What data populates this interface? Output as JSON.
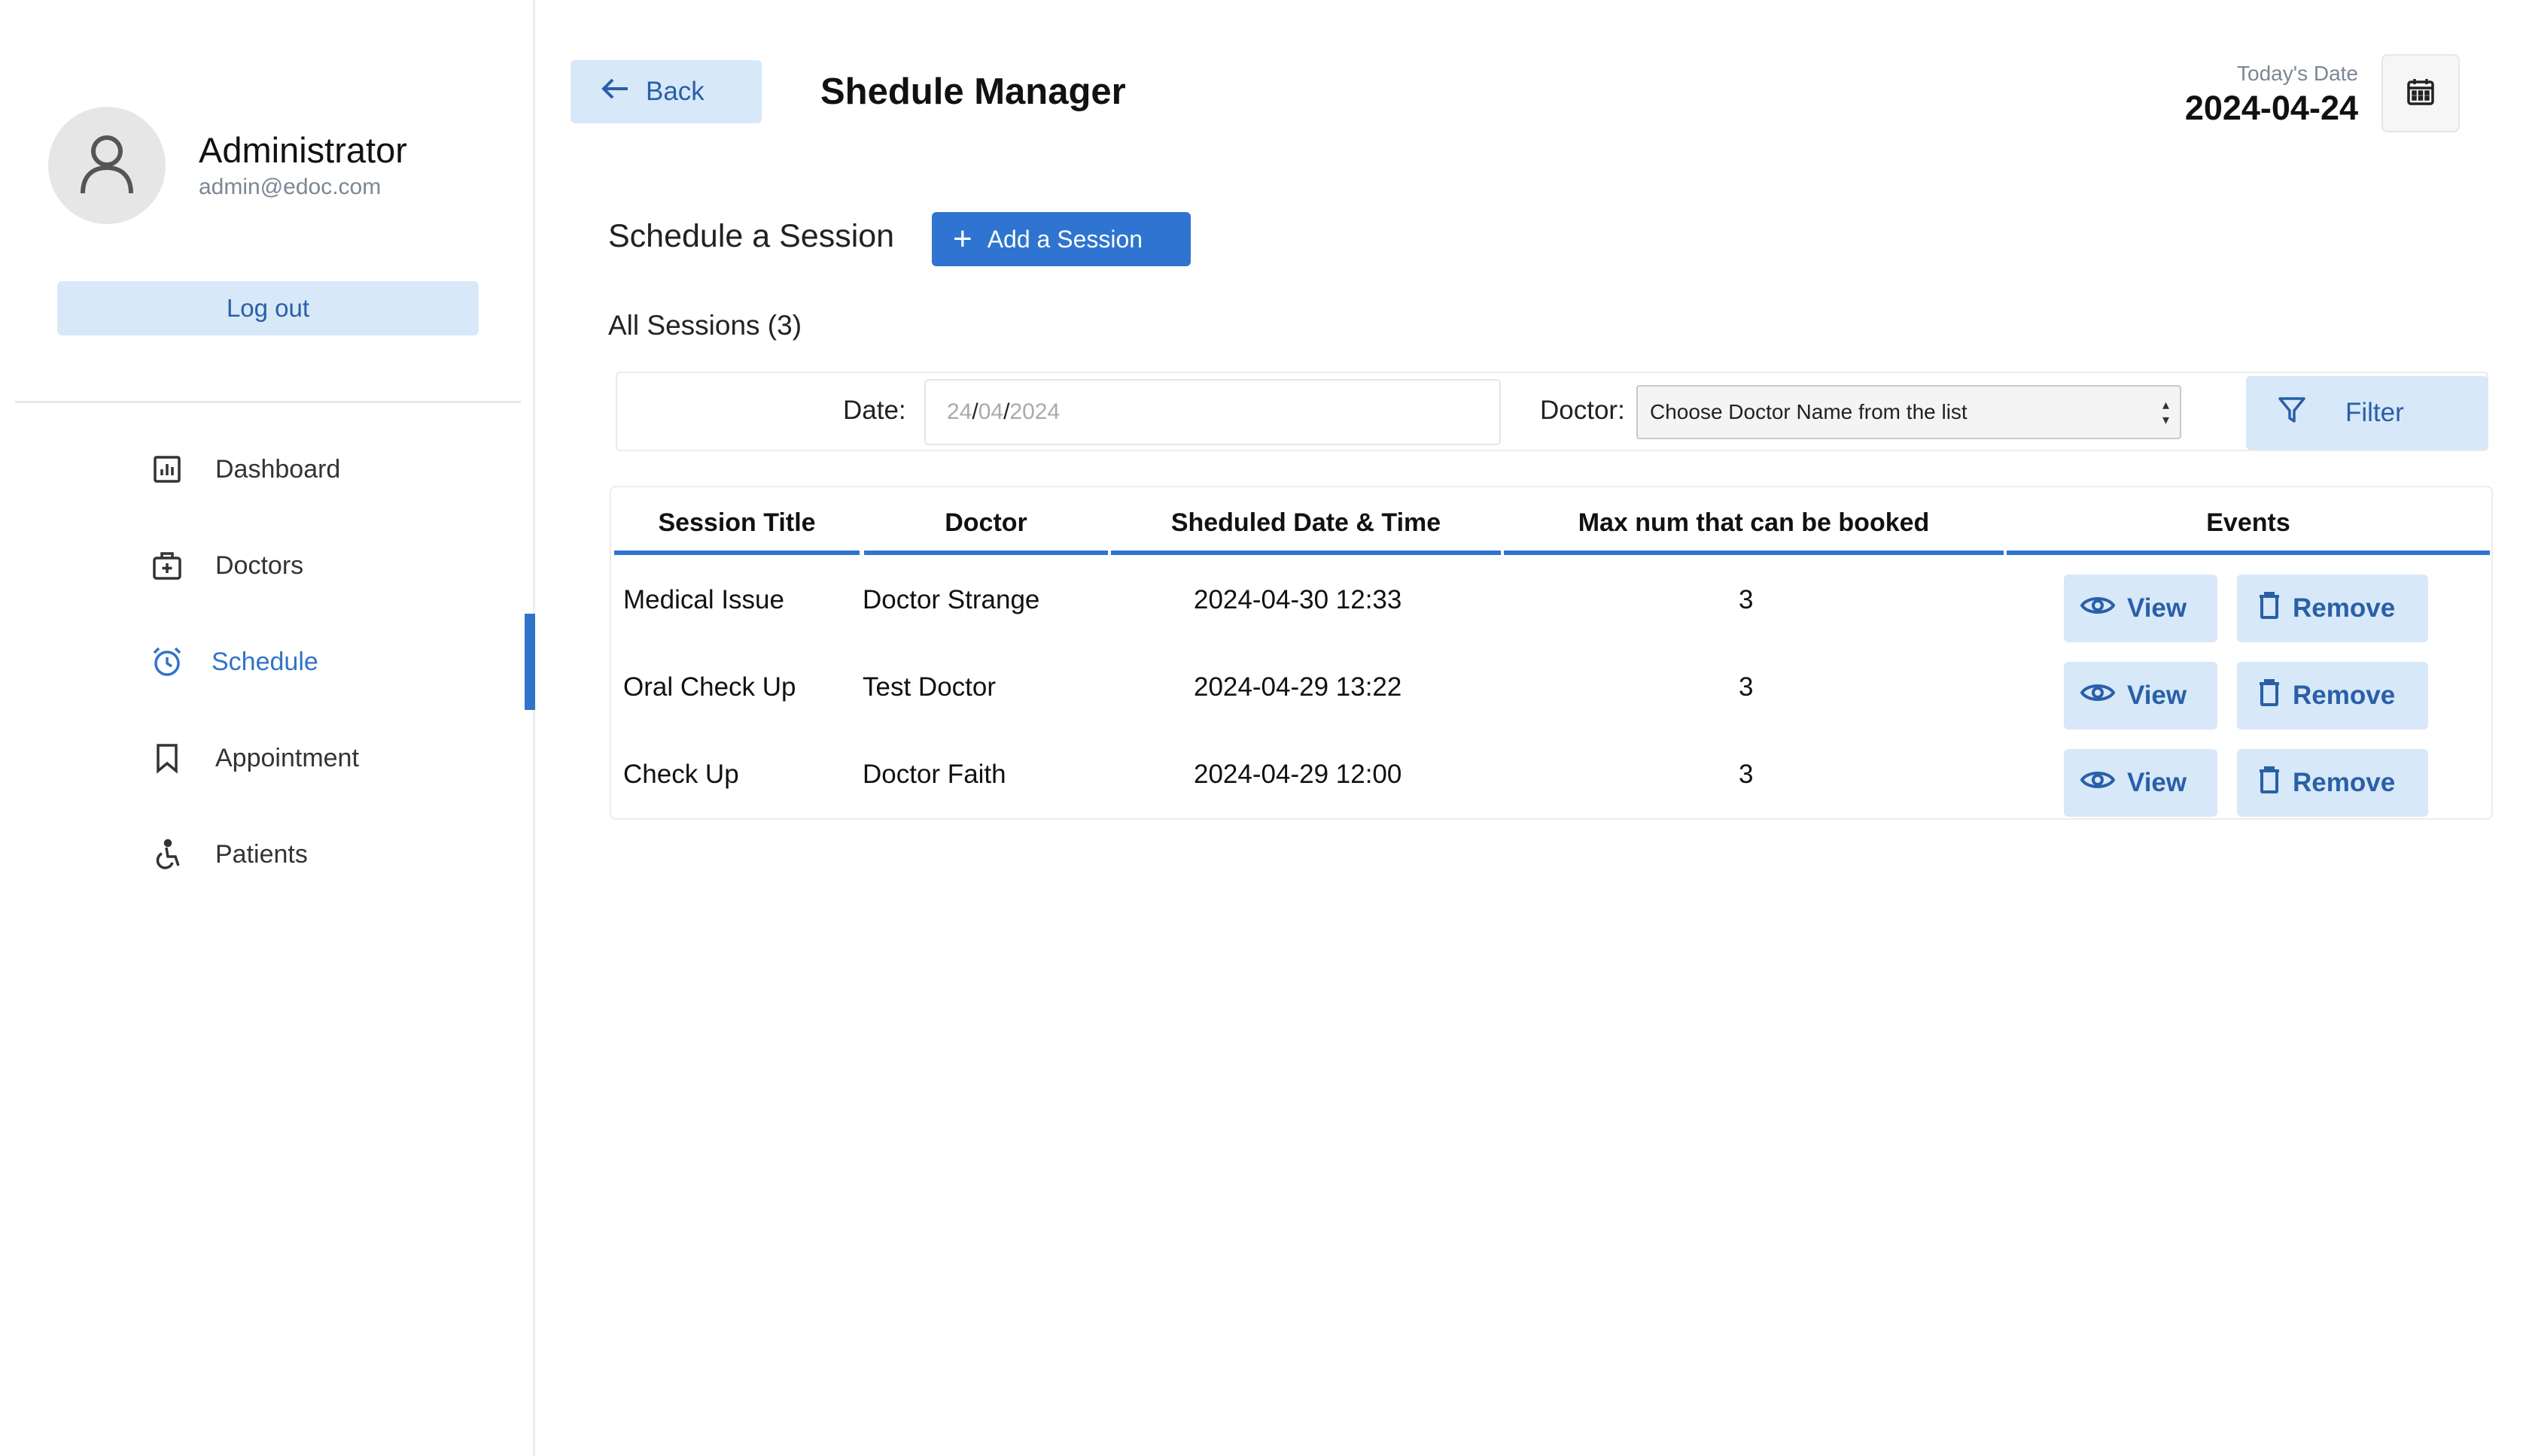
{
  "sidebar": {
    "profile": {
      "name": "Administrator",
      "email": "admin@edoc.com",
      "avatar_icon": "user-icon"
    },
    "logout_label": "Log out",
    "nav": [
      {
        "label": "Dashboard",
        "icon": "dashboard-icon"
      },
      {
        "label": "Doctors",
        "icon": "doctor-bag-icon"
      },
      {
        "label": "Schedule",
        "icon": "alarm-clock-icon",
        "active": true
      },
      {
        "label": "Appointment",
        "icon": "bookmark-icon"
      },
      {
        "label": "Patients",
        "icon": "wheelchair-icon"
      }
    ]
  },
  "header": {
    "back_label": "Back",
    "title": "Shedule Manager",
    "today_label": "Today's Date",
    "today_value": "2024-04-24",
    "calendar_icon": "calendar-icon"
  },
  "schedule": {
    "label": "Schedule a Session",
    "add_label": "Add a Session",
    "all_sessions": "All Sessions (3)"
  },
  "filter": {
    "date_label": "Date:",
    "date_day": "24",
    "date_month": "04",
    "date_year": "2024",
    "doctor_label": "Doctor:",
    "doctor_placeholder": "Choose Doctor Name from the list",
    "button_label": "Filter"
  },
  "table": {
    "headers": [
      "Session Title",
      "Doctor",
      "Sheduled Date & Time",
      "Max num that can be booked",
      "Events"
    ],
    "rows": [
      {
        "title": "Medical Issue",
        "doctor": "Doctor Strange",
        "datetime": "2024-04-30 12:33",
        "max": "3"
      },
      {
        "title": "Oral Check Up",
        "doctor": "Test Doctor",
        "datetime": "2024-04-29 13:22",
        "max": "3"
      },
      {
        "title": "Check Up",
        "doctor": "Doctor Faith",
        "datetime": "2024-04-29 12:00",
        "max": "3"
      }
    ],
    "view_label": "View",
    "remove_label": "Remove"
  },
  "colors": {
    "accent": "#2f74d0",
    "soft_button": "#d7e8f8",
    "soft_button_text": "#2a5fa8"
  }
}
